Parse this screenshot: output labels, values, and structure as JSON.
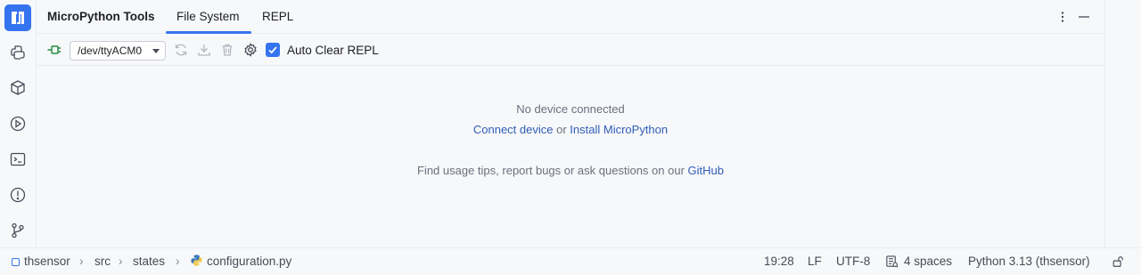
{
  "colors": {
    "accent": "#3574f0",
    "link": "#2f5db7",
    "plug_green": "#208a3c"
  },
  "sidebar": {
    "icons": [
      "micropython-logo-icon",
      "python-console-icon",
      "python-packages-icon",
      "run-icon",
      "terminal-icon",
      "problems-icon",
      "git-icon"
    ]
  },
  "tool_window": {
    "title": "MicroPython Tools",
    "tabs": [
      {
        "label": "File System",
        "active": true
      },
      {
        "label": "REPL",
        "active": false
      }
    ]
  },
  "toolbar": {
    "device_select_value": "/dev/ttyACM0",
    "auto_clear_label": "Auto Clear REPL",
    "auto_clear_checked": true
  },
  "empty_state": {
    "status": "No device connected",
    "connect_link": "Connect device",
    "or_text": "or",
    "install_link": "Install MicroPython",
    "tips_text": "Find usage tips, report bugs or ask questions on our",
    "github_link": "GitHub"
  },
  "statusbar": {
    "breadcrumb": [
      "thsensor",
      "src",
      "states",
      "configuration.py"
    ],
    "position": "19:28",
    "line_separator": "LF",
    "encoding": "UTF-8",
    "indent": "4 spaces",
    "interpreter": "Python 3.13 (thsensor)"
  }
}
